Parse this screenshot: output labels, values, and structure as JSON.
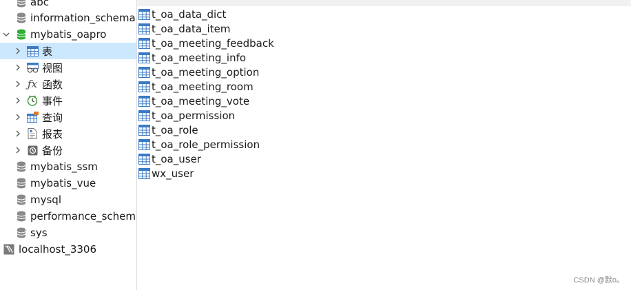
{
  "sidebar": {
    "databases_top": [
      {
        "label": "abc"
      },
      {
        "label": "information_schema"
      }
    ],
    "open_db": {
      "label": "mybatis_oapro",
      "children": [
        {
          "label": "表",
          "icon": "table-icon"
        },
        {
          "label": "视图",
          "icon": "view-icon"
        },
        {
          "label": "函数",
          "icon": "function-icon"
        },
        {
          "label": "事件",
          "icon": "event-clock-icon"
        },
        {
          "label": "查询",
          "icon": "query-icon"
        },
        {
          "label": "报表",
          "icon": "report-icon"
        },
        {
          "label": "备份",
          "icon": "backup-icon"
        }
      ]
    },
    "databases_bottom": [
      {
        "label": "mybatis_ssm"
      },
      {
        "label": "mybatis_vue"
      },
      {
        "label": "mysql"
      },
      {
        "label": "performance_schema"
      },
      {
        "label": "sys"
      }
    ],
    "connection": {
      "label": "localhost_3306"
    }
  },
  "tables": [
    "t_oa_data_dict",
    "t_oa_data_item",
    "t_oa_meeting_feedback",
    "t_oa_meeting_info",
    "t_oa_meeting_option",
    "t_oa_meeting_room",
    "t_oa_meeting_vote",
    "t_oa_permission",
    "t_oa_role",
    "t_oa_role_permission",
    "t_oa_user",
    "wx_user"
  ],
  "watermark": "CSDN @默o。",
  "colors": {
    "selection": "#cce8ff",
    "db_icon": "#8a8a8a",
    "open_db_icon": "#2fae35",
    "table_icon": "#3b7ac6"
  }
}
